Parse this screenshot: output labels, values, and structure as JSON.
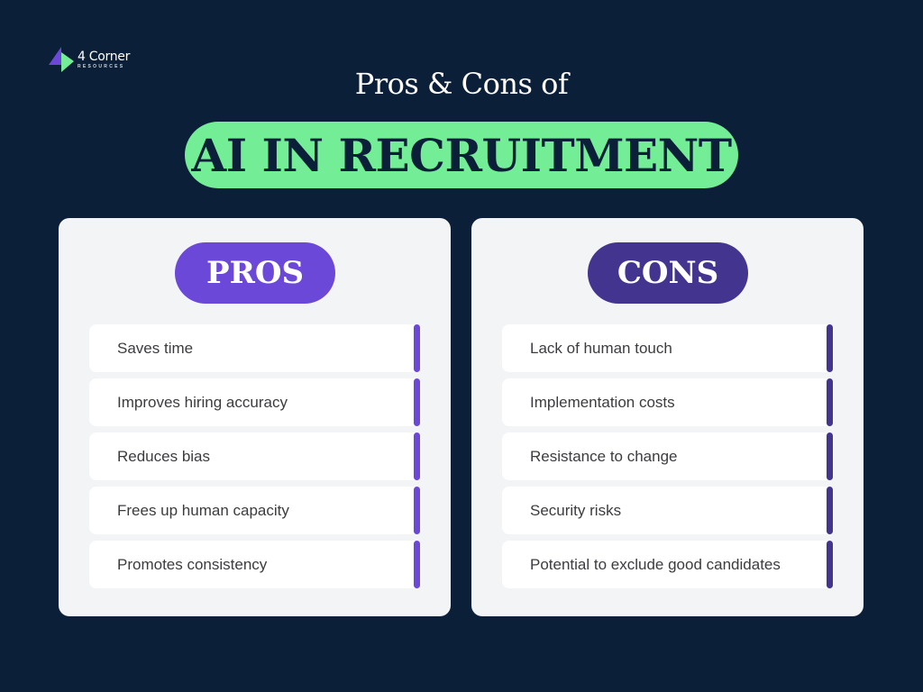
{
  "logo": {
    "name": "4 Corner",
    "subtitle": "RESOURCES"
  },
  "header": {
    "subtitle": "Pros & Cons of",
    "title": "AI IN RECRUITMENT"
  },
  "colors": {
    "background": "#0b1f38",
    "title_pill": "#74ed97",
    "pros_accent": "#6c48d8",
    "cons_accent": "#43358f",
    "card": "#f2f4f6"
  },
  "pros": {
    "label": "PROS",
    "items": [
      "Saves time",
      "Improves hiring accuracy",
      "Reduces bias",
      "Frees up human capacity",
      "Promotes consistency"
    ]
  },
  "cons": {
    "label": "CONS",
    "items": [
      "Lack of human touch",
      "Implementation costs",
      "Resistance to change",
      "Security risks",
      "Potential to exclude good candidates"
    ]
  }
}
